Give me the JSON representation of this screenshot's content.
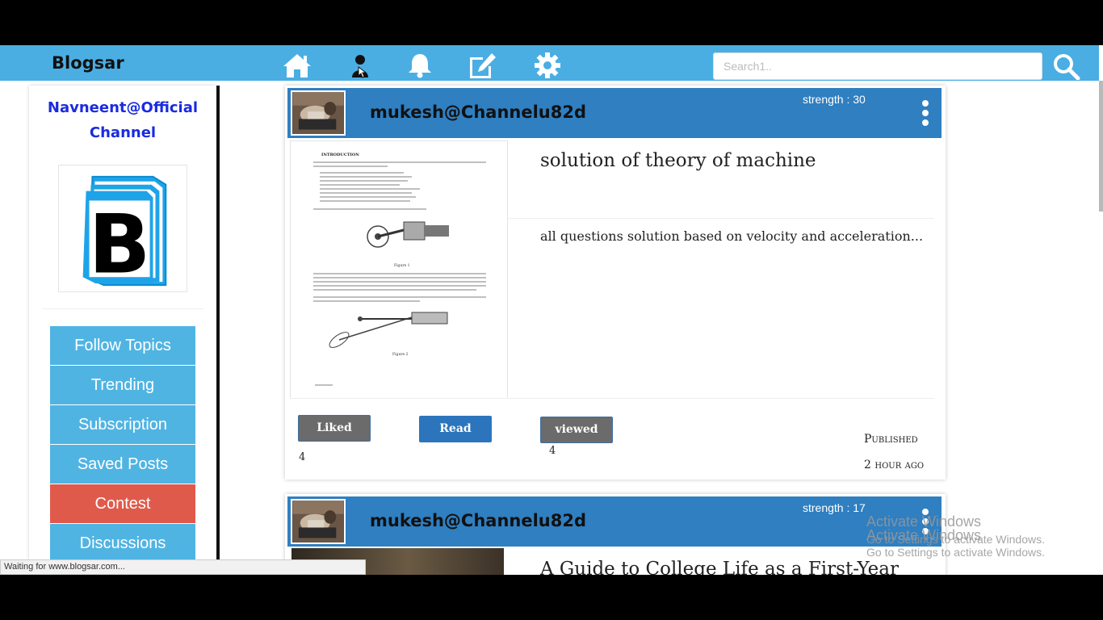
{
  "navbar": {
    "brand": "Blogsar",
    "icons": [
      "home-icon",
      "user-icon",
      "bell-icon",
      "edit-icon",
      "gear-icon"
    ],
    "search_placeholder": "Search1..",
    "search_icon": "search-icon",
    "color": "#4aaee3"
  },
  "sidebar": {
    "channel_name": "Navneent@Official Channel",
    "logo_letter": "B",
    "buttons": [
      {
        "label": "Follow Topics",
        "active": false
      },
      {
        "label": "Trending",
        "active": false
      },
      {
        "label": "Subscription",
        "active": false
      },
      {
        "label": "Saved Posts",
        "active": false
      },
      {
        "label": "Contest",
        "active": true
      },
      {
        "label": "Discussions",
        "active": false
      }
    ],
    "button_color": "#50b4e3",
    "active_color": "#e05a4b"
  },
  "posts": [
    {
      "author": "mukesh@Channelu82d",
      "strength": "strength : 30",
      "title": "solution of theory of machine",
      "description": "all questions solution based on velocity and acceleration...",
      "liked_label": "Liked",
      "liked_count": "4",
      "read_label": "Read",
      "viewed_label": "viewed",
      "viewed_count": "4",
      "published": "Published",
      "time_ago": "2 hour ago",
      "document_preview": {
        "heading": "INTRODUCTION",
        "figure_labels": [
          "Figure 1",
          "Figure 2"
        ]
      }
    },
    {
      "author": "mukesh@Channelu82d",
      "strength": "strength : 17",
      "title": "A Guide to College Life as a First-Year"
    }
  ],
  "status_bar": "Waiting for www.blogsar.com...",
  "watermark": {
    "line1": "Activate Windows",
    "line2": "Go to Settings to activate Windows."
  }
}
